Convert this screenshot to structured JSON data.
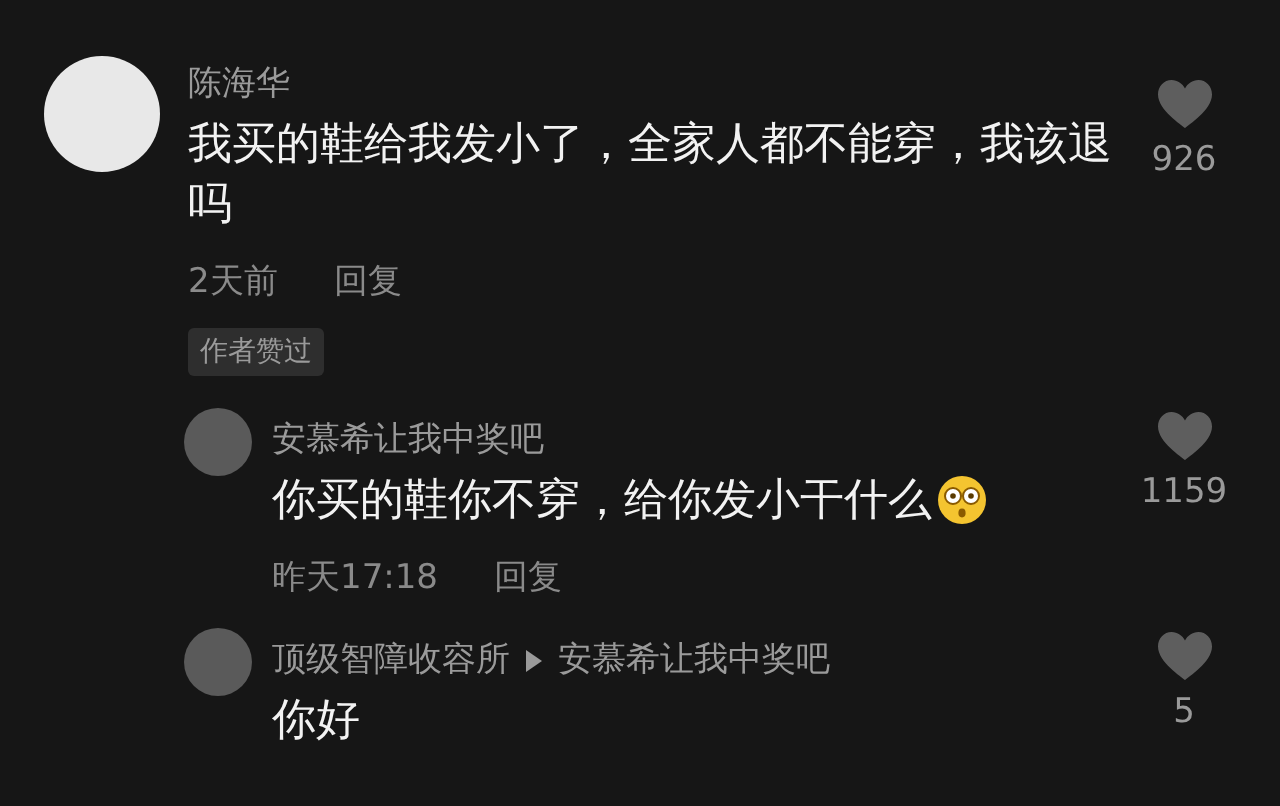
{
  "comments": [
    {
      "author": "陈海华",
      "text": "我买的鞋给我发小了，全家人都不能穿，我该退吗",
      "time": "2天前",
      "reply_label": "回复",
      "badge": "作者赞过",
      "likes": "926",
      "is_reply": false
    },
    {
      "author": "安慕希让我中奖吧",
      "text": "你买的鞋你不穿，给你发小干什么",
      "has_emoji": true,
      "time": "昨天17:18",
      "reply_label": "回复",
      "likes": "1159",
      "is_reply": true
    },
    {
      "author": "顶级智障收容所",
      "reply_to": "安慕希让我中奖吧",
      "text": "你好",
      "likes": "5",
      "is_reply": true
    }
  ]
}
